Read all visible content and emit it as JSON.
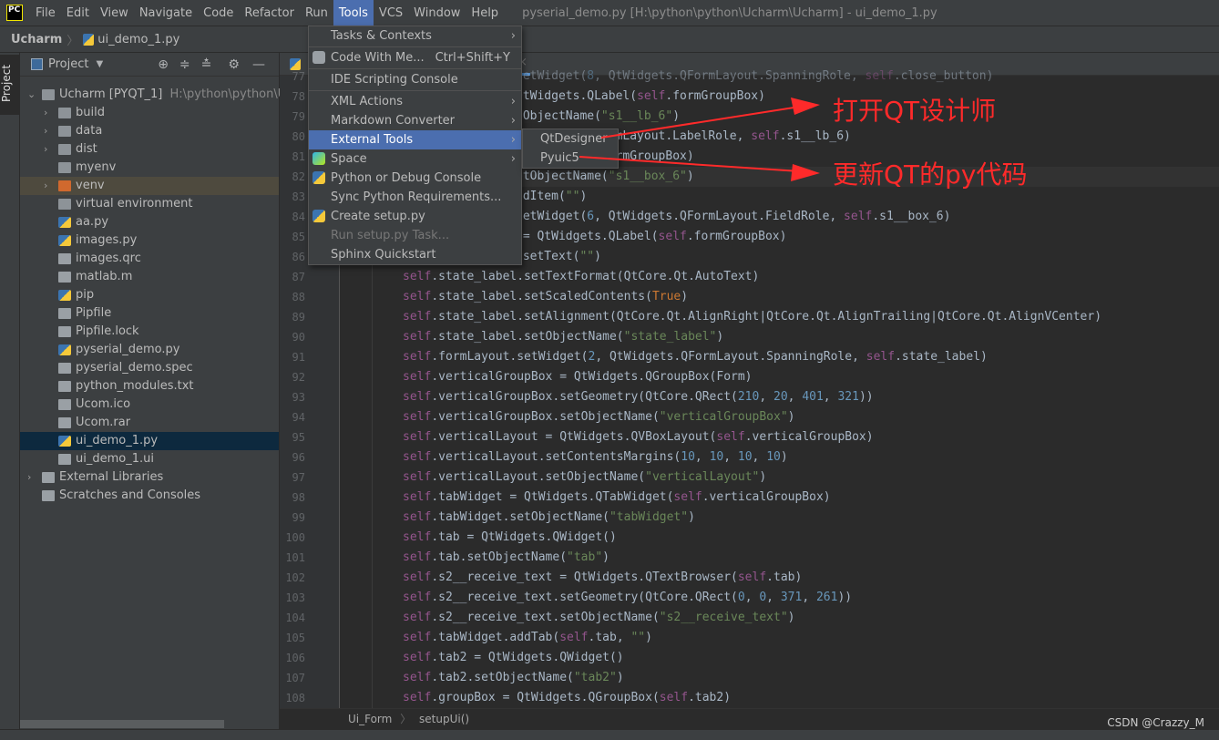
{
  "menubar": {
    "logo": "PC",
    "items": [
      "File",
      "Edit",
      "View",
      "Navigate",
      "Code",
      "Refactor",
      "Run",
      "Tools",
      "VCS",
      "Window",
      "Help"
    ],
    "active": "Tools",
    "window_title": "pyserial_demo.py [H:\\python\\python\\Ucharm\\Ucharm] - ui_demo_1.py"
  },
  "navbar": {
    "project": "Ucharm",
    "file": "ui_demo_1.py"
  },
  "sidebar_tab": "Project",
  "project_panel": {
    "title": "Project",
    "tree": [
      {
        "label": "Ucharm [PYQT_1]",
        "path": "H:\\python\\python\\Uch",
        "type": "folder",
        "expanded": true,
        "depth": 0
      },
      {
        "label": "build",
        "type": "folder",
        "collapsed": true,
        "depth": 1
      },
      {
        "label": "data",
        "type": "folder",
        "collapsed": true,
        "depth": 1
      },
      {
        "label": "dist",
        "type": "folder",
        "collapsed": true,
        "depth": 1
      },
      {
        "label": "myenv",
        "type": "folder",
        "depth": 1
      },
      {
        "label": "venv",
        "type": "folder-excluded",
        "collapsed": true,
        "depth": 1
      },
      {
        "label": "virtual environment",
        "type": "folder",
        "depth": 1
      },
      {
        "label": "aa.py",
        "type": "py",
        "depth": 1
      },
      {
        "label": "images.py",
        "type": "py",
        "depth": 1
      },
      {
        "label": "images.qrc",
        "type": "qrc",
        "depth": 1
      },
      {
        "label": "matlab.m",
        "type": "file",
        "depth": 1
      },
      {
        "label": "pip",
        "type": "py",
        "depth": 1
      },
      {
        "label": "Pipfile",
        "type": "file",
        "depth": 1
      },
      {
        "label": "Pipfile.lock",
        "type": "file",
        "depth": 1
      },
      {
        "label": "pyserial_demo.py",
        "type": "py",
        "depth": 1
      },
      {
        "label": "pyserial_demo.spec",
        "type": "file",
        "depth": 1
      },
      {
        "label": "python_modules.txt",
        "type": "file",
        "depth": 1
      },
      {
        "label": "Ucom.ico",
        "type": "file",
        "depth": 1
      },
      {
        "label": "Ucom.rar",
        "type": "file",
        "depth": 1
      },
      {
        "label": "ui_demo_1.py",
        "type": "py",
        "depth": 1,
        "selected": true
      },
      {
        "label": "ui_demo_1.ui",
        "type": "ui",
        "depth": 1
      },
      {
        "label": "External Libraries",
        "type": "lib",
        "collapsed": true,
        "depth": 0
      },
      {
        "label": "Scratches and Consoles",
        "type": "scratch",
        "depth": 0
      }
    ]
  },
  "editor": {
    "lines": [
      {
        "n": 77,
        "text": "setWidget(8, QtWidgets.QFormLayout.SpanningRole, self.close_button)",
        "partial": true
      },
      {
        "n": 78,
        "text": "QtWidgets.QLabel(self.formGroupBox)",
        "partial": true
      },
      {
        "n": 79,
        "text": "tObjectName(\"s1__lb_6\")",
        "partial": true
      },
      {
        "n": 80,
        "text": "QtWidgets.QFormLayout.LabelRole, self.s1__lb_6)",
        "partial": true
      },
      {
        "n": 81,
        "text": "mboBox(self.formGroupBox)",
        "partial": true
      },
      {
        "n": 82,
        "text": "etObjectName(\"s1__box_6\")",
        "partial": true
      },
      {
        "n": 83,
        "text": "ddItem(\"\")",
        "partial": true
      },
      {
        "n": 84,
        "text": "setWidget(6, QtWidgets.QFormLayout.FieldRole, self.s1__box_6)",
        "partial": true
      },
      {
        "n": 85,
        "text": " = QtWidgets.QLabel(self.formGroupBox)",
        "partial": true
      },
      {
        "n": 86,
        "text": ".setText(\"\")",
        "partial": true
      },
      {
        "n": 87,
        "text": "self.state_label.setTextFormat(QtCore.Qt.AutoText)"
      },
      {
        "n": 88,
        "text": "self.state_label.setScaledContents(True)"
      },
      {
        "n": 89,
        "text": "self.state_label.setAlignment(QtCore.Qt.AlignRight|QtCore.Qt.AlignTrailing|QtCore.Qt.AlignVCenter)"
      },
      {
        "n": 90,
        "text": "self.state_label.setObjectName(\"state_label\")"
      },
      {
        "n": 91,
        "text": "self.formLayout.setWidget(2, QtWidgets.QFormLayout.SpanningRole, self.state_label)"
      },
      {
        "n": 92,
        "text": "self.verticalGroupBox = QtWidgets.QGroupBox(Form)"
      },
      {
        "n": 93,
        "text": "self.verticalGroupBox.setGeometry(QtCore.QRect(210, 20, 401, 321))"
      },
      {
        "n": 94,
        "text": "self.verticalGroupBox.setObjectName(\"verticalGroupBox\")"
      },
      {
        "n": 95,
        "text": "self.verticalLayout = QtWidgets.QVBoxLayout(self.verticalGroupBox)"
      },
      {
        "n": 96,
        "text": "self.verticalLayout.setContentsMargins(10, 10, 10, 10)"
      },
      {
        "n": 97,
        "text": "self.verticalLayout.setObjectName(\"verticalLayout\")"
      },
      {
        "n": 98,
        "text": "self.tabWidget = QtWidgets.QTabWidget(self.verticalGroupBox)"
      },
      {
        "n": 99,
        "text": "self.tabWidget.setObjectName(\"tabWidget\")"
      },
      {
        "n": 100,
        "text": "self.tab = QtWidgets.QWidget()"
      },
      {
        "n": 101,
        "text": "self.tab.setObjectName(\"tab\")"
      },
      {
        "n": 102,
        "text": "self.s2__receive_text = QtWidgets.QTextBrowser(self.tab)"
      },
      {
        "n": 103,
        "text": "self.s2__receive_text.setGeometry(QtCore.QRect(0, 0, 371, 261))"
      },
      {
        "n": 104,
        "text": "self.s2__receive_text.setObjectName(\"s2__receive_text\")"
      },
      {
        "n": 105,
        "text": "self.tabWidget.addTab(self.tab, \"\")"
      },
      {
        "n": 106,
        "text": "self.tab2 = QtWidgets.QWidget()"
      },
      {
        "n": 107,
        "text": "self.tab2.setObjectName(\"tab2\")"
      },
      {
        "n": 108,
        "text": "self.groupBox = QtWidgets.QGroupBox(self.tab2)"
      }
    ],
    "current_line": 82,
    "breadcrumb": [
      "Ui_Form",
      "setupUi()"
    ]
  },
  "tools_menu": {
    "items": [
      {
        "label": "Tasks & Contexts",
        "submenu": true
      },
      {
        "label": "Code With Me...",
        "shortcut": "Ctrl+Shift+Y",
        "icon": "people-icon"
      },
      {
        "label": "IDE Scripting Console"
      },
      {
        "label": "XML Actions",
        "submenu": true
      },
      {
        "label": "Markdown Converter",
        "submenu": true
      },
      {
        "label": "External Tools",
        "submenu": true,
        "highlighted": true
      },
      {
        "label": "Space",
        "submenu": true,
        "icon": "space-icon"
      },
      {
        "label": "Python or Debug Console",
        "icon": "python-icon"
      },
      {
        "label": "Sync Python Requirements..."
      },
      {
        "label": "Create setup.py",
        "icon": "python-file-icon"
      },
      {
        "label": "Run setup.py Task...",
        "disabled": true
      },
      {
        "label": "Sphinx Quickstart"
      }
    ]
  },
  "external_tools_submenu": {
    "items": [
      "QtDesigner",
      "Pyuic5"
    ]
  },
  "annotations": {
    "open_designer": "打开QT设计师",
    "update_code": "更新QT的py代码",
    "color": "#ff2a2a"
  },
  "watermark": "CSDN @Crazzy_M",
  "colors": {
    "accent": "#4b6eaf",
    "selected_row": "#0d293e",
    "self": "#94558d",
    "string": "#6a8759",
    "number": "#6897bb",
    "keyword": "#cc7832"
  }
}
